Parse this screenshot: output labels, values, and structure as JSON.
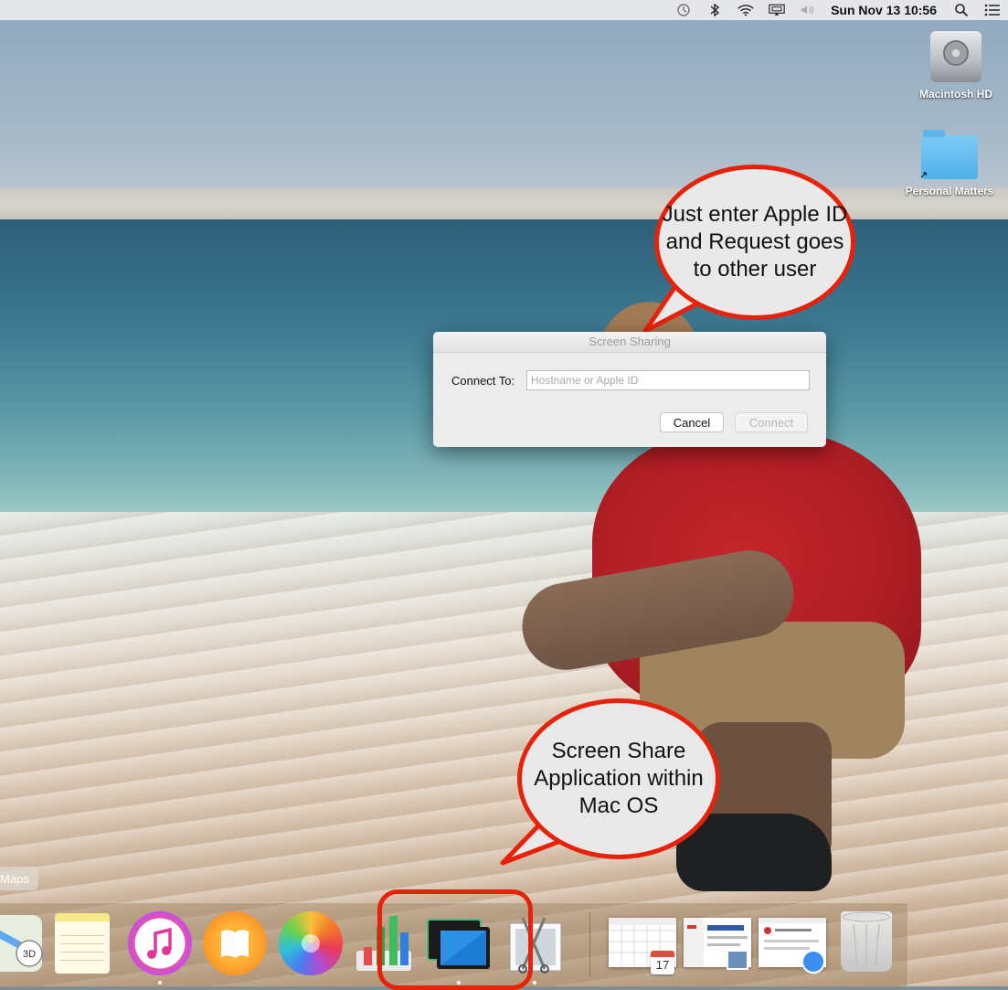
{
  "menubar": {
    "icons": [
      "time-machine-icon",
      "bluetooth-icon",
      "wifi-icon",
      "airplay-icon",
      "volume-icon",
      "spotlight-icon",
      "notification-center-icon"
    ],
    "clock": "Sun Nov 13  10:56"
  },
  "desktop": {
    "items": [
      {
        "label": "Macintosh HD",
        "icon": "hard-drive-icon"
      },
      {
        "label": "Personal Matters",
        "icon": "folder-icon"
      }
    ]
  },
  "callouts": {
    "top": "Just enter Apple ID and Request goes to other user",
    "bottom": "Screen Share Application within Mac OS"
  },
  "dialog": {
    "title": "Screen Sharing",
    "field_label": "Connect To:",
    "field_value": "",
    "field_placeholder": "Hostname or Apple ID",
    "cancel_label": "Cancel",
    "connect_label": "Connect"
  },
  "dock": {
    "tooltip": "Maps",
    "apps": [
      "Maps",
      "Notes",
      "iTunes",
      "iBooks",
      "Photos",
      "Numbers",
      "Screen Sharing",
      "Preview",
      "Calendar window",
      "Mail window",
      "Safari window",
      "Trash"
    ],
    "calendar_day": "17",
    "highlight_color": "#e8210a"
  },
  "colors": {
    "accent_callout_border": "#e8210a",
    "callout_fill": "#e9e9e9"
  }
}
